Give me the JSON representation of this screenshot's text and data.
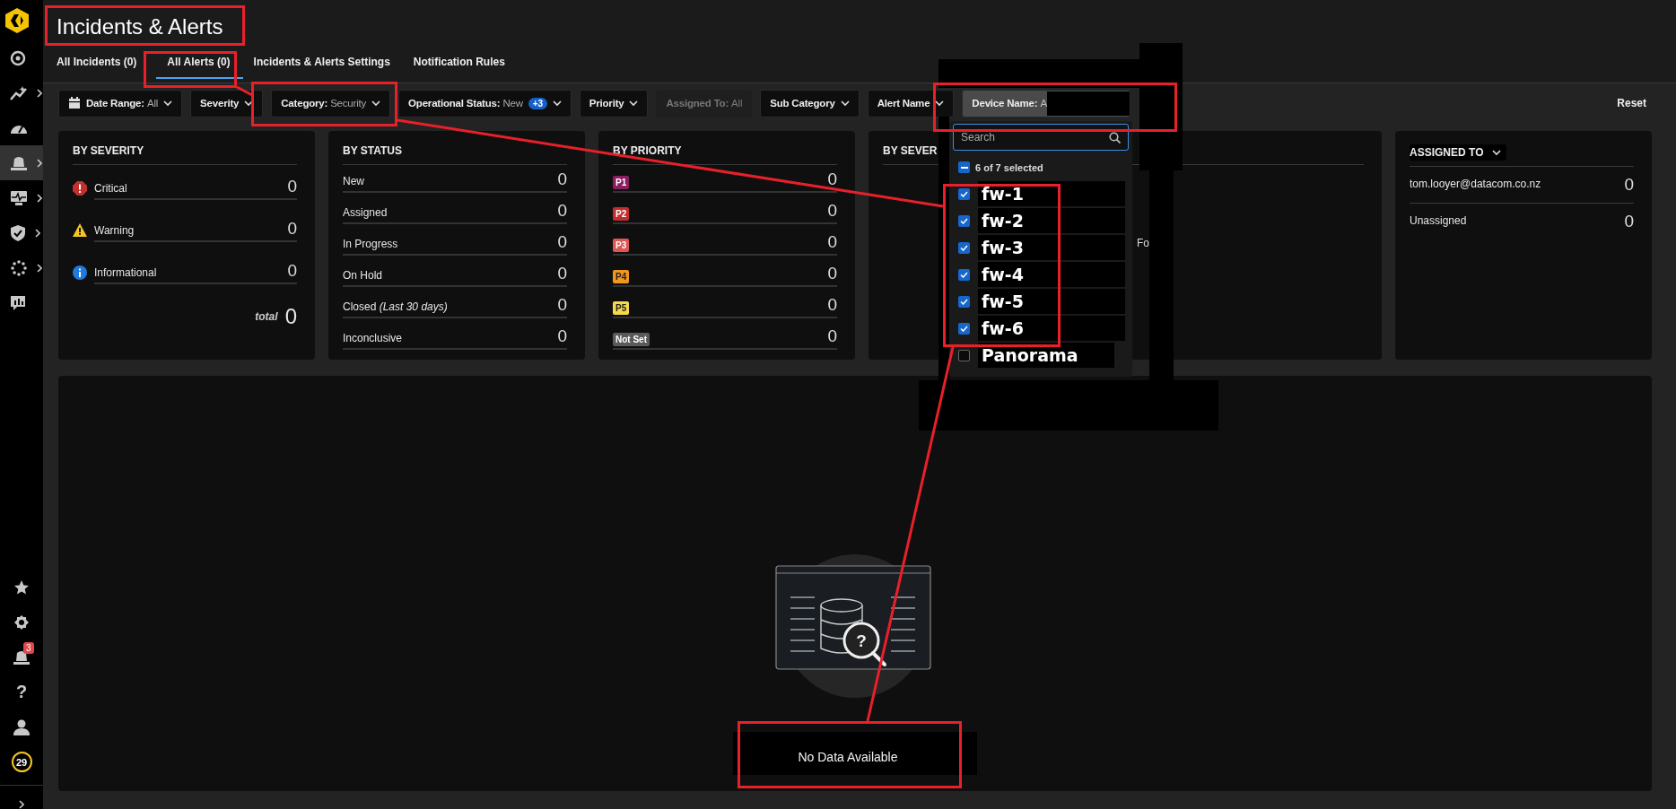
{
  "sidebar": {
    "top": [
      {
        "kind": "radar",
        "expandable": false,
        "selected": false
      },
      {
        "kind": "trend",
        "expandable": true,
        "selected": false
      },
      {
        "kind": "gauge",
        "expandable": false,
        "selected": false
      },
      {
        "kind": "bell",
        "expandable": true,
        "selected": true
      },
      {
        "kind": "monitor",
        "expandable": true,
        "selected": false
      },
      {
        "kind": "shield",
        "expandable": true,
        "selected": false
      },
      {
        "kind": "dots",
        "expandable": true,
        "selected": false
      },
      {
        "kind": "board",
        "expandable": false,
        "selected": false
      }
    ],
    "bottom": [
      {
        "kind": "star"
      },
      {
        "kind": "gear"
      },
      {
        "kind": "bell",
        "badge": "3"
      },
      {
        "kind": "help",
        "glyph": "?"
      },
      {
        "kind": "user"
      },
      {
        "kind": "counter",
        "label": "29"
      }
    ]
  },
  "title": "Incidents & Alerts",
  "tabs": [
    {
      "label": "All Incidents (0)",
      "selected": false
    },
    {
      "label": "All Alerts (0)",
      "selected": true
    },
    {
      "label": "Incidents & Alerts Settings",
      "selected": false
    },
    {
      "label": "Notification Rules",
      "selected": false
    }
  ],
  "filters": [
    {
      "kind": "date",
      "label": "Date Range:",
      "value": "All",
      "disabled": false,
      "open": false
    },
    {
      "kind": "select",
      "label": "Severity",
      "disabled": false,
      "open": false
    },
    {
      "kind": "select",
      "label": "Category:",
      "value": "Security",
      "disabled": false,
      "open": false
    },
    {
      "kind": "select",
      "label": "Operational Status:",
      "value": "New",
      "badge": "+3",
      "disabled": false,
      "open": false
    },
    {
      "kind": "select",
      "label": "Priority",
      "disabled": false,
      "open": false
    },
    {
      "kind": "select",
      "label": "Assigned To:",
      "value": "All",
      "disabled": true,
      "open": false
    },
    {
      "kind": "select",
      "label": "Sub Category",
      "disabled": false,
      "open": false
    },
    {
      "kind": "select",
      "label": "Alert Name",
      "disabled": false,
      "open": false
    },
    {
      "kind": "select",
      "label": "Device Name:",
      "value": "A",
      "disabled": false,
      "open": true
    }
  ],
  "reset": "Reset",
  "cards": [
    {
      "kind": "severity",
      "title": "BY SEVERITY",
      "rows": [
        {
          "kind": "critical",
          "label": "Critical",
          "count": "0"
        },
        {
          "kind": "warning",
          "label": "Warning",
          "count": "0"
        },
        {
          "kind": "info",
          "label": "Informational",
          "count": "0"
        }
      ],
      "total_label": "total",
      "total": "0"
    },
    {
      "kind": "status",
      "title": "BY STATUS",
      "rows": [
        {
          "label": "New",
          "count": "0"
        },
        {
          "label": "Assigned",
          "count": "0"
        },
        {
          "label": "In Progress",
          "count": "0"
        },
        {
          "label": "On Hold",
          "count": "0"
        },
        {
          "label": "Closed *(Last 30 days)*",
          "count": "0"
        },
        {
          "label": "Inconclusive",
          "count": "0"
        }
      ]
    },
    {
      "kind": "priority",
      "title": "BY PRIORITY",
      "rows": [
        {
          "label": "P1",
          "color": "#8c1d63",
          "count": "0"
        },
        {
          "label": "P2",
          "color": "#c12e2e",
          "count": "0"
        },
        {
          "label": "P3",
          "color": "#de5553",
          "count": "0"
        },
        {
          "label": "P4",
          "color": "#f2961c",
          "count": "0"
        },
        {
          "label": "P5",
          "color": "#f6d94a",
          "count": "0"
        },
        {
          "label": "Not Set",
          "color": "#5a5a5a",
          "count": "0"
        }
      ]
    },
    {
      "kind": "covered",
      "title": "BY SEVER",
      "note": "Fo"
    },
    {
      "kind": "assigned",
      "title": "ASSIGNED TO",
      "rows": [
        {
          "label": "tom.looyer@datacom.co.nz",
          "count": "0"
        },
        {
          "label": "Unassigned",
          "count": "0"
        }
      ]
    }
  ],
  "device_dropdown": {
    "placeholder": "Search",
    "summary": "6 of 7 selected",
    "select_all_indeterminate": true,
    "items": [
      {
        "label": "fw-1",
        "checked": true
      },
      {
        "label": "fw-2",
        "checked": true
      },
      {
        "label": "fw-3",
        "checked": true
      },
      {
        "label": "fw-4",
        "checked": true
      },
      {
        "label": "fw-5",
        "checked": true
      },
      {
        "label": "fw-6",
        "checked": true
      },
      {
        "label": "Panorama",
        "checked": false
      }
    ]
  },
  "empty_state": {
    "glyph": "?",
    "message": "No Data Available"
  }
}
